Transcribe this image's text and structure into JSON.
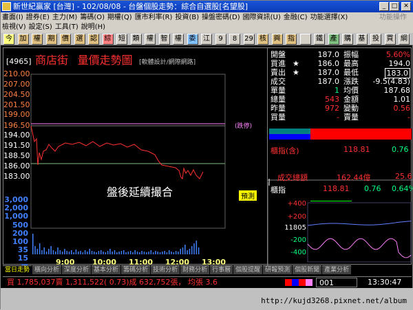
{
  "window": {
    "title": "新世紀贏家 [台灣] - 102/08/08 - 台盤個股走勢：綜合自選股[名望股]"
  },
  "menu": {
    "row1": [
      "畫面(I)",
      "證券(E)",
      "主力(M)",
      "籌碼(O)",
      "期權(Q)",
      "匯市利率(R)",
      "投資(B)",
      "操盤密碼(D)",
      "國際資訊(U)",
      "金融(C)",
      "功能選擇(X)"
    ],
    "row1_gray": "功能操作",
    "row2": [
      "檢視(V)",
      "設定(S)",
      "工具(T)",
      "說明(H)"
    ]
  },
  "toolbar": [
    "今",
    "加",
    "權",
    "期",
    "價",
    "選",
    "認",
    "綜",
    "短",
    "類",
    "權",
    "智",
    "權",
    "委",
    "江",
    "9",
    "8",
    "29",
    "核",
    "興",
    "指",
    "",
    "鐵",
    "產",
    "購",
    "基",
    "投",
    "買",
    "綱"
  ],
  "stock": {
    "code": "[4965]",
    "name": "商店街",
    "chart_title": "量價走勢圖",
    "credit": "[軟體設計/網際網路]",
    "note": "盤後延續撮合",
    "predict": "預測",
    "limit_label": "(跌停)"
  },
  "price_axis": [
    "210.00",
    "207.00",
    "204.50",
    "201.50",
    "199.00",
    "196.50",
    "194.00",
    "191.50",
    "188.50",
    "186.00",
    "183.00"
  ],
  "volume_axis": [
    "3,000",
    "2,000",
    "1,000",
    "500",
    "200",
    "100",
    "35",
    "15",
    "張"
  ],
  "time_axis": [
    "9:00",
    "10:00",
    "11:00",
    "12:00",
    "13:00"
  ],
  "quote": {
    "open_l": "開盤",
    "open": "187.0",
    "amp_l": "振幅",
    "amp": "5.60%",
    "bid_l": "買進",
    "bid": "186.0",
    "high_l": "最高",
    "high": "194.0",
    "ask_l": "賣出",
    "ask": "187.0",
    "low_l": "最低",
    "low": "183.0",
    "deal_l": "成交",
    "deal": "187.0",
    "chg_l": "漲跌",
    "chg": "-9.5(4.83)",
    "single_l": "單量",
    "single": "1",
    "avg_l": "均價",
    "avg": "187.68",
    "tot_l": "總量",
    "tot": "543",
    "amt_l": "金額",
    "amt": "1.01",
    "yest_l": "昨量",
    "yest": "972",
    "turn_l": "變動",
    "turn": "0.56",
    "buyv_l": "買量",
    "buyv": "-",
    "sellv_l": "賣量",
    "sellv": "-"
  },
  "index": {
    "label": "櫃指(含)",
    "value": "118.81",
    "chg": "0.76",
    "total_label": "成交總額",
    "total": "162.44億",
    "total2": "25.6"
  },
  "mini": {
    "label": "櫃指",
    "value": "118.81",
    "chg": "0.76",
    "pct": "0.64%",
    "axis": [
      "+400",
      "+200",
      "11805",
      "-200",
      "-400"
    ]
  },
  "tabs": [
    "當日走勢",
    "橫向分析",
    "深度分析",
    "基本分析",
    "籌碼分析",
    "技術分析",
    "財務分析",
    "行事曆",
    "個股提醒",
    "研報預測",
    "個股新聞",
    "產業分析"
  ],
  "status": {
    "text": "買 1,785,037賣 1,311,522( 0.73)成 632,752張，  均張 3.6",
    "code": "001",
    "time": "13:30:47"
  },
  "url": "http://kujd3268.pixnet.net/album"
}
